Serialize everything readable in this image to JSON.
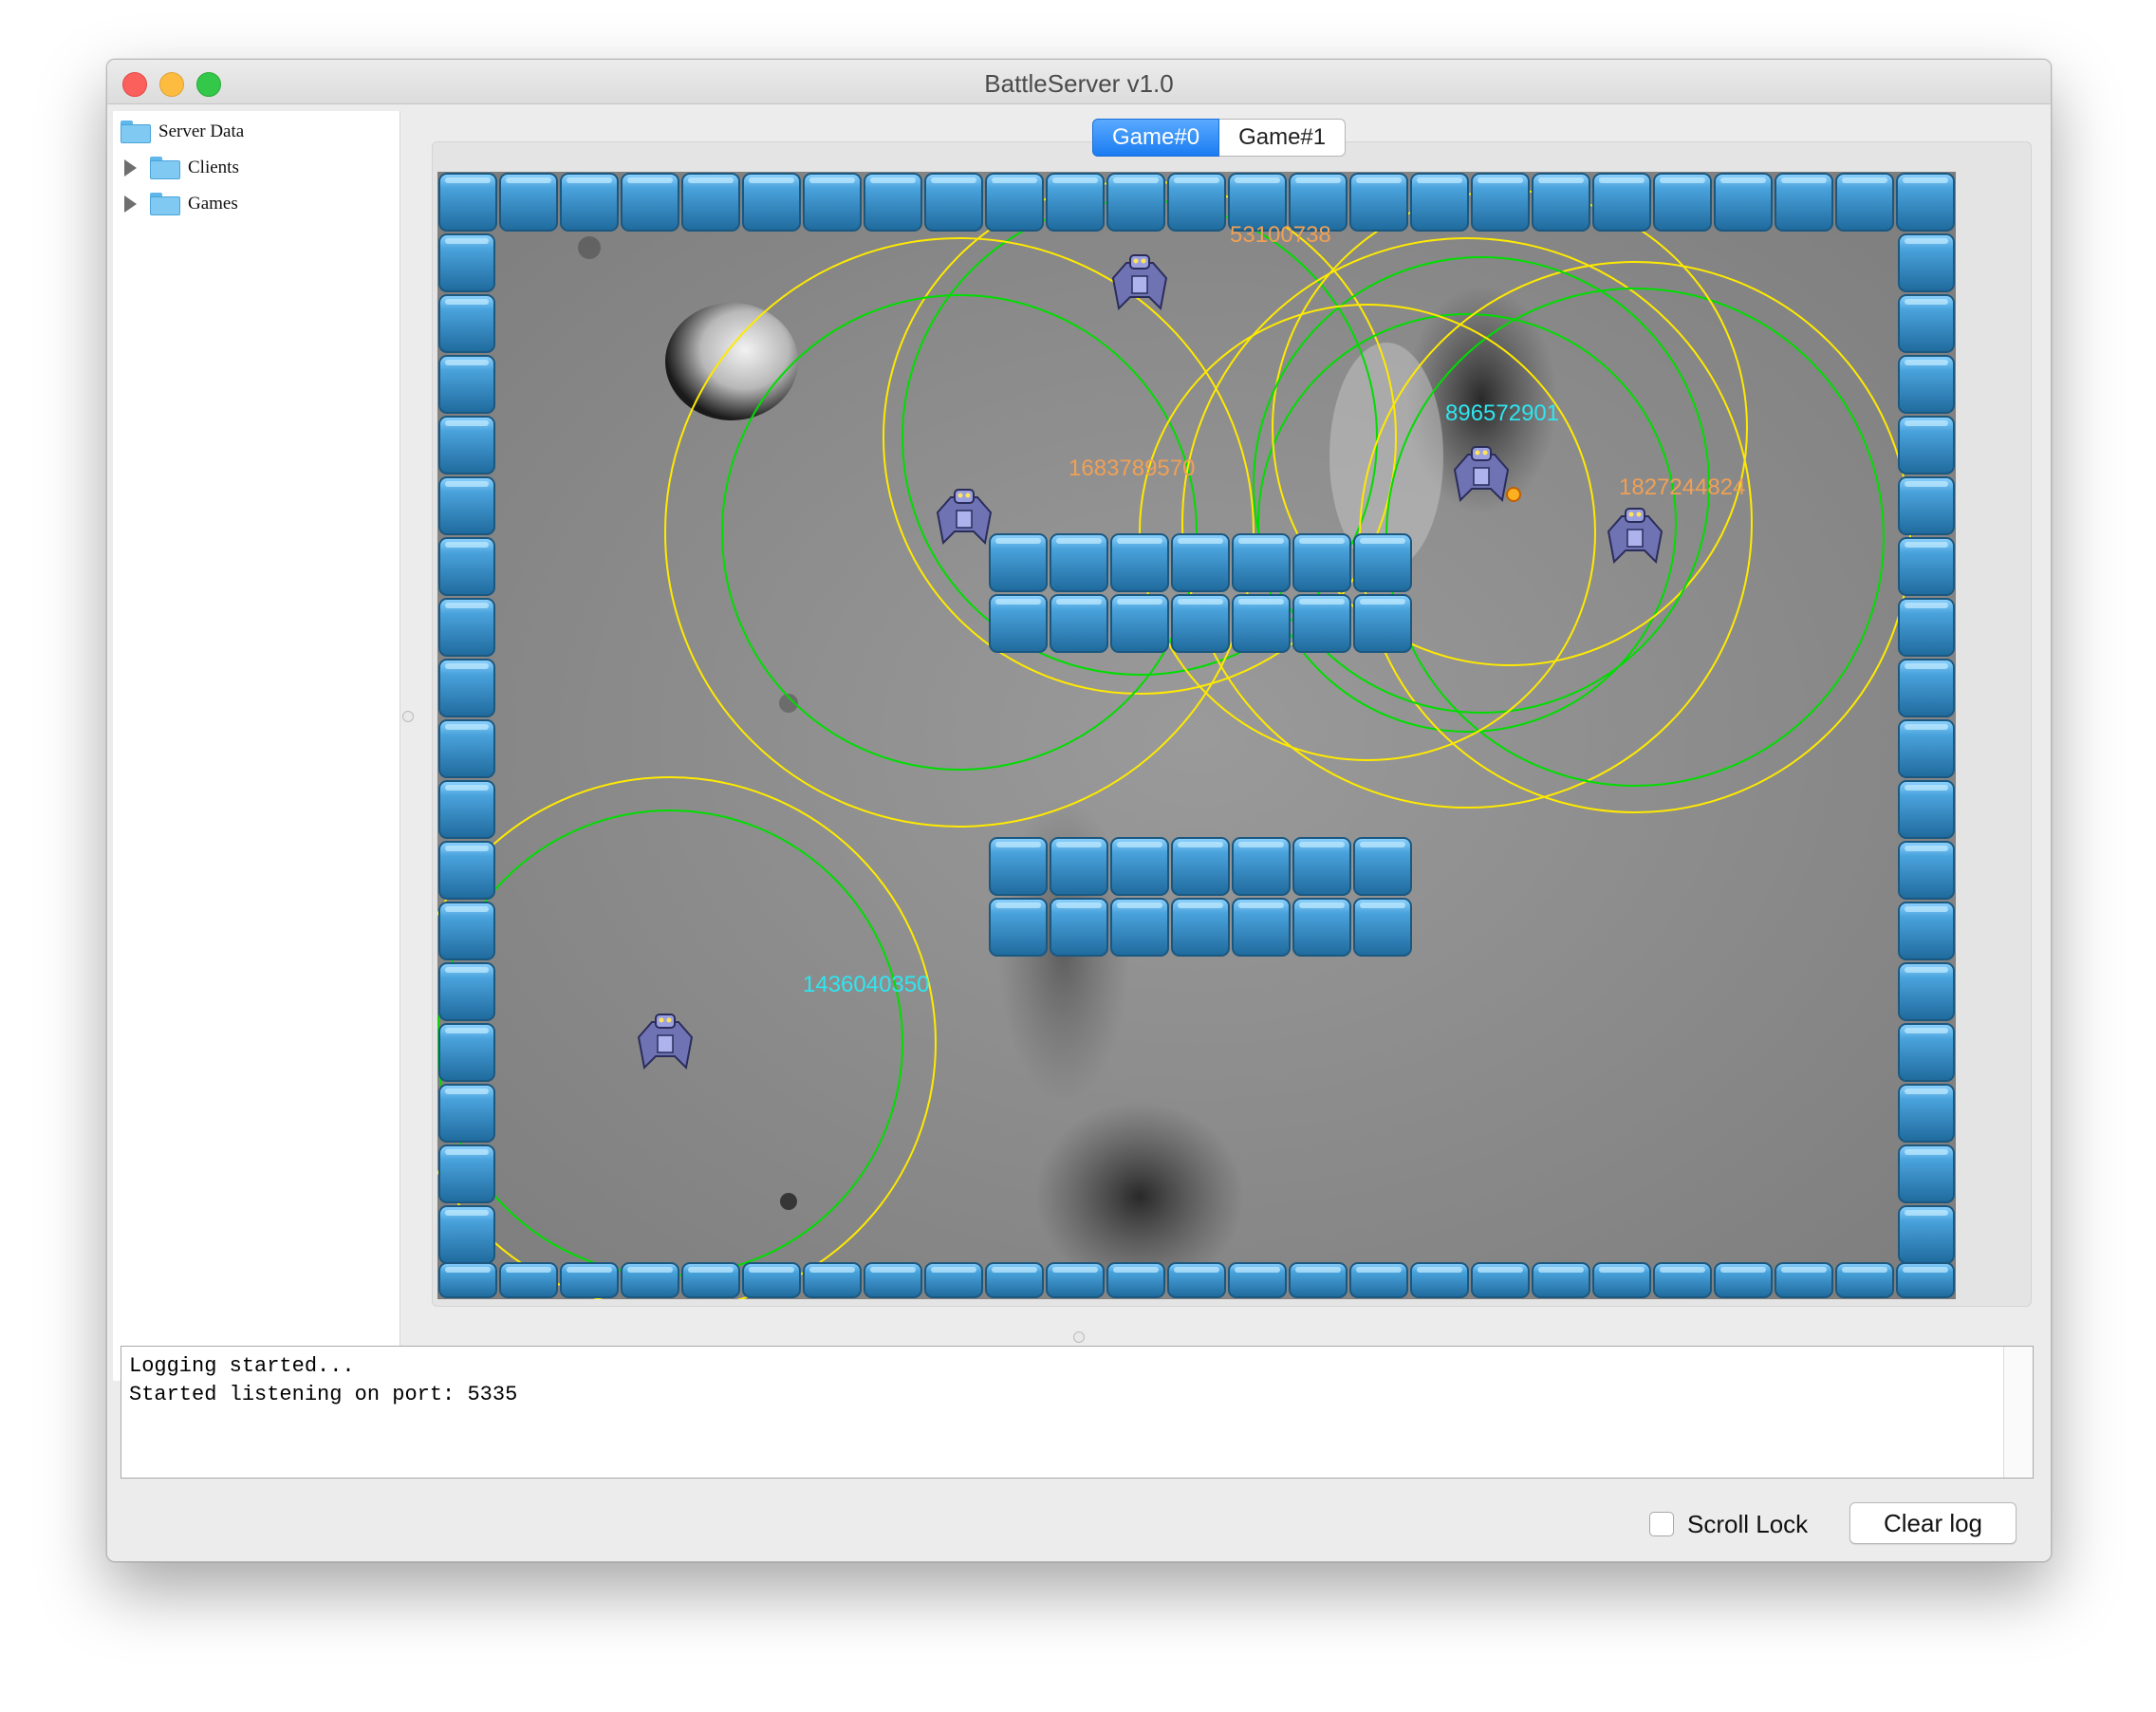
{
  "window": {
    "title": "BattleServer v1.0"
  },
  "tree": {
    "root_label": "Server Data",
    "items": [
      {
        "label": "Clients",
        "expanded": false
      },
      {
        "label": "Games",
        "expanded": false
      }
    ]
  },
  "tabs": [
    {
      "label": "Game#0",
      "selected": true
    },
    {
      "label": "Game#1",
      "selected": false
    }
  ],
  "arena": {
    "robots": [
      {
        "id": "53100738",
        "label_color": "#f0a055"
      },
      {
        "id": "1683789570",
        "label_color": "#f0a055"
      },
      {
        "id": "896572901",
        "label_color": "#2ee6f0"
      },
      {
        "id": "1827244824",
        "label_color": "#f0a055"
      },
      {
        "id": "1436040350",
        "label_color": "#2ee6f0"
      }
    ],
    "colors": {
      "wall": "#3e8fc4",
      "scan_yellow": "#ffea00",
      "scan_green": "#00dd00",
      "ground": "#8f8f8f"
    }
  },
  "log": {
    "lines": [
      "Logging started...",
      "Started listening on port: 5335"
    ]
  },
  "controls": {
    "scroll_lock_label": "Scroll Lock",
    "scroll_lock_checked": false,
    "clear_button_label": "Clear log"
  }
}
